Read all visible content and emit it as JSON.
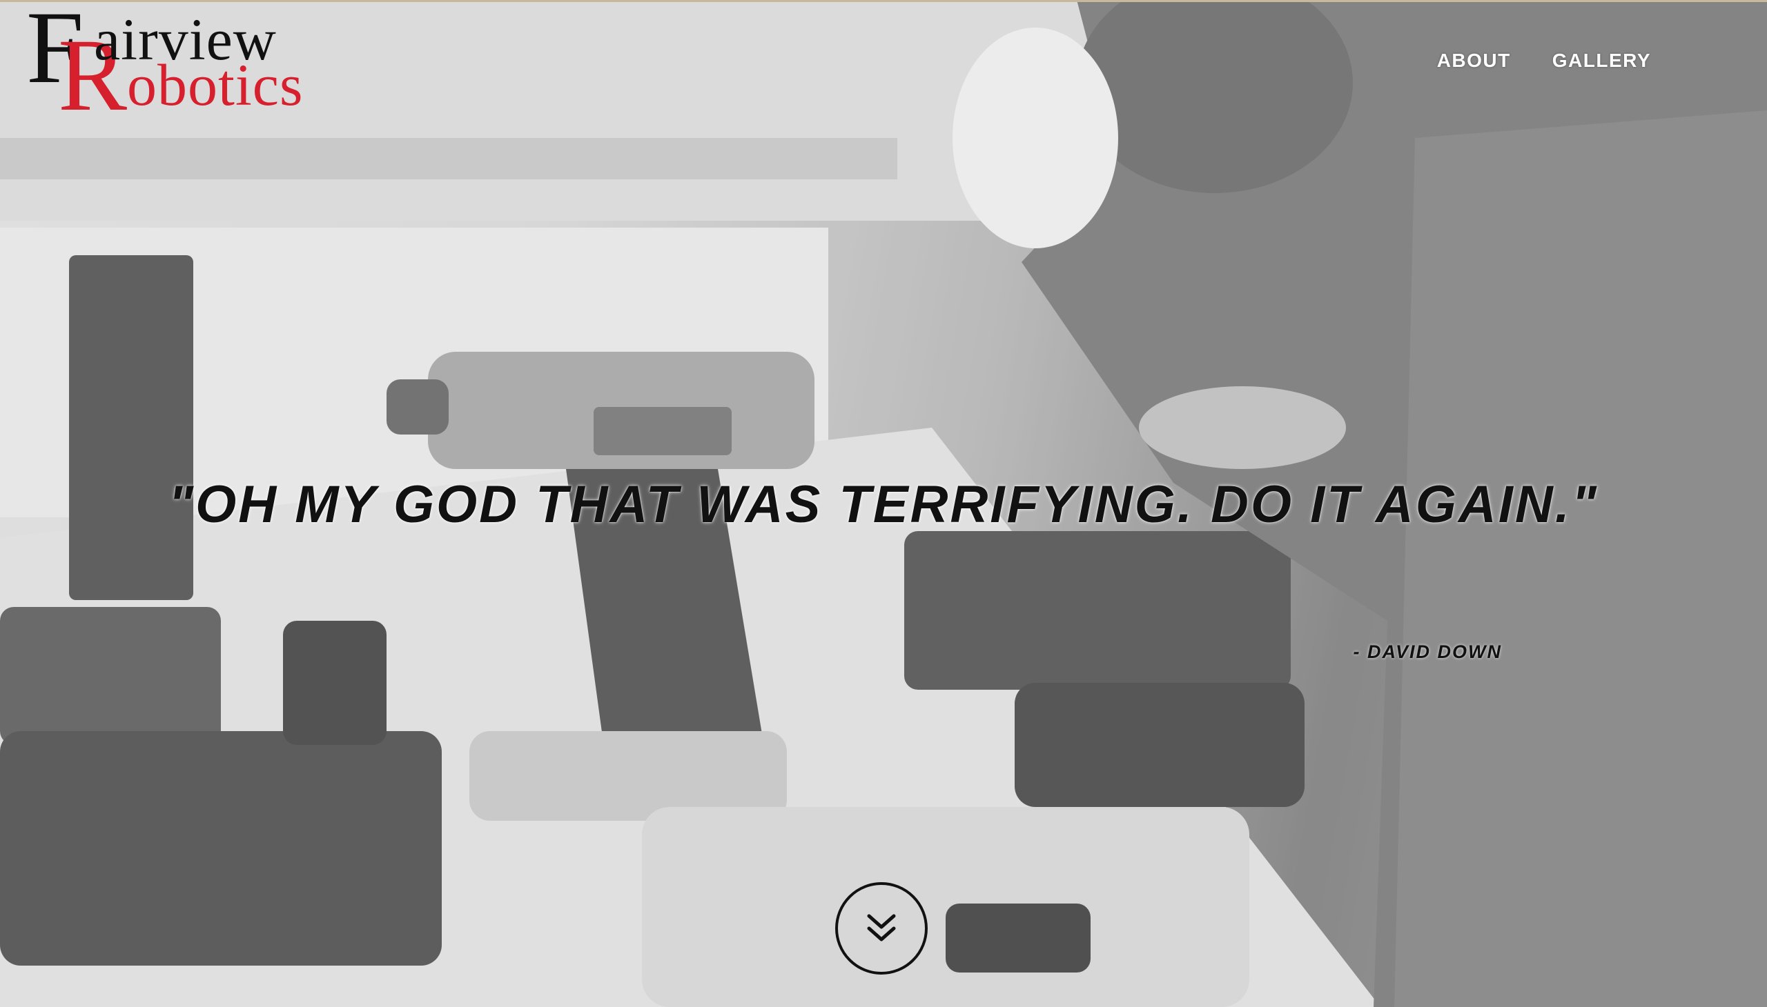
{
  "logo": {
    "initial_top": "F",
    "initial_bottom": "R",
    "word_top": "airview",
    "word_bottom": "obotics",
    "colors": {
      "dark": "#111111",
      "red": "#d6202e"
    }
  },
  "nav": {
    "items": [
      {
        "label": "ABOUT"
      },
      {
        "label": "GALLERY"
      }
    ]
  },
  "hero": {
    "quote": "\"OH MY GOD THAT WAS TERRIFYING. DO IT AGAIN.\"",
    "attribution": "- DAVID DOWN",
    "background_description_icons": [
      "drill-image",
      "vise-image",
      "battery-image"
    ]
  },
  "scroll": {
    "icon": "double-chevron-down-icon"
  }
}
